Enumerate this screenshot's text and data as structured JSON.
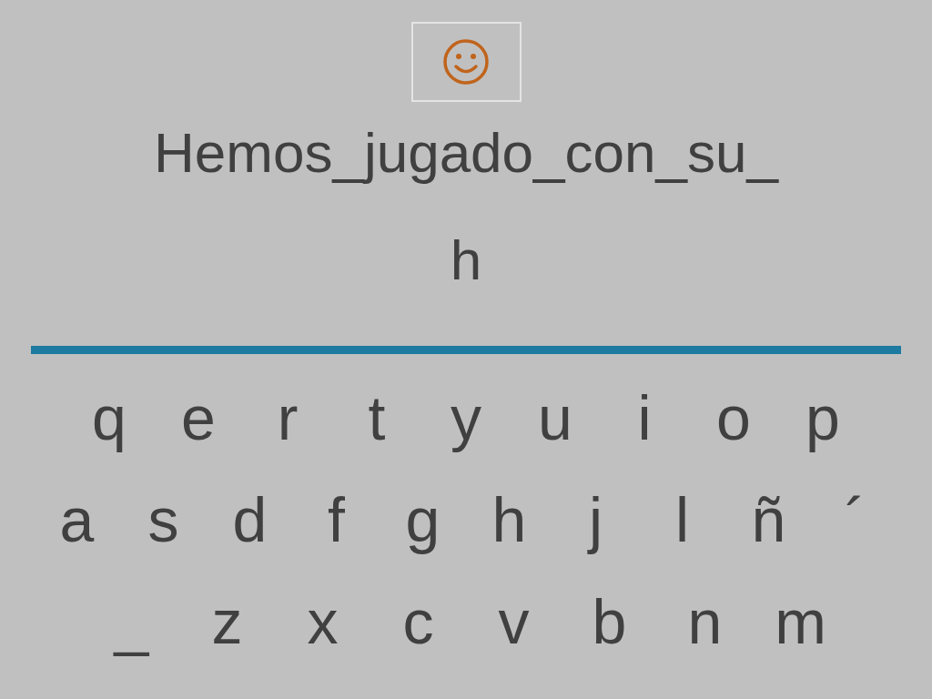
{
  "sentence": "Hemos_jugado_con_su_",
  "answer": "h",
  "keyboard": [
    [
      "q",
      "e",
      "r",
      "t",
      "y",
      "u",
      "i",
      "o",
      "p"
    ],
    [
      "a",
      "s",
      "d",
      "f",
      "g",
      "h",
      "j",
      "l",
      "ñ",
      "´"
    ],
    [
      "_",
      "z",
      "x",
      "c",
      "v",
      "b",
      "n",
      "m"
    ]
  ]
}
